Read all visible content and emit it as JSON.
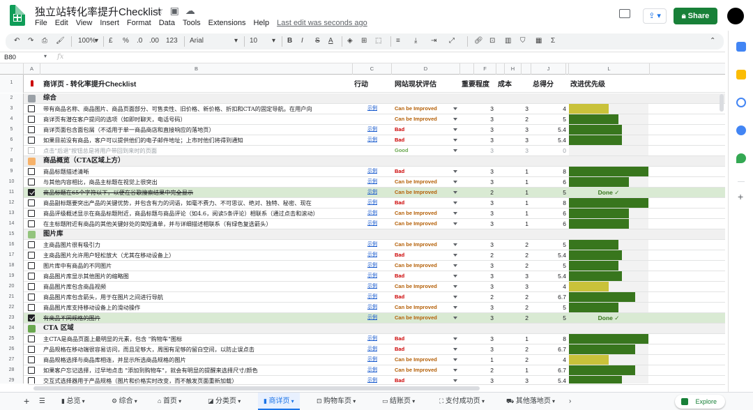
{
  "doc_title": "独立站转化率提升Checklist",
  "menu": [
    "File",
    "Edit",
    "View",
    "Insert",
    "Format",
    "Data",
    "Tools",
    "Extensions",
    "Help"
  ],
  "last_edit": "Last edit was seconds ago",
  "share_label": "Share",
  "toolbar": {
    "zoom": "100%",
    "currency": "£",
    "percent": "%",
    "dec_dec": ".0",
    "dec_inc": ".00",
    "format_more": "123",
    "font": "Arial",
    "font_size": "10",
    "bold": "B",
    "italic": "I",
    "strike": "S",
    "text_color": "A"
  },
  "name_box": "B80",
  "fx": "fx",
  "columns": [
    "A",
    "B",
    "C",
    "D",
    "",
    "F",
    "",
    "H",
    "",
    "J",
    "",
    "L"
  ],
  "header_row": {
    "num": "1",
    "title": "商详页 - 转化率提升Checklist",
    "action": "行动",
    "status": "网站现状评估",
    "importance": "重要程度",
    "cost": "成本",
    "total": "总得分",
    "priority": "改进优先级"
  },
  "colors": {
    "green_bar": "#38761d",
    "yellow_bar": "#c9c23a",
    "improved": "#b45f06",
    "bad": "#cc0000",
    "good": "#6aa84f",
    "share": "#188038",
    "done_bg": "#d9ead3"
  },
  "rows": [
    {
      "num": "2",
      "type": "section",
      "icon": "gear-icon",
      "text": "综合"
    },
    {
      "num": "3",
      "type": "item",
      "text": "带有商品名称、商品图片、商品页面部分、可售卖性、旧价格、新价格、折扣和CTA的固定导航。在用户向",
      "link": "示例",
      "status": "Can be Improved",
      "imp": "3",
      "cost": "3",
      "total": "4",
      "bar": 0.5,
      "barcolor": "yellow"
    },
    {
      "num": "4",
      "type": "item",
      "text": "商详页有潜在客户提问的选项（如即时聊天，电话号码）",
      "link": "",
      "status": "Can be Improved",
      "imp": "3",
      "cost": "2",
      "total": "5",
      "bar": 0.62,
      "barcolor": "green"
    },
    {
      "num": "5",
      "type": "item",
      "text": "商详页面包含面包屑（不适用于单一商品商店和直接响应的落地页）",
      "link": "示例",
      "status": "Bad",
      "imp": "3",
      "cost": "3",
      "total": "5.4",
      "bar": 0.67,
      "barcolor": "green"
    },
    {
      "num": "6",
      "type": "item",
      "text": "如果目前没有商品，客户可以提供他们的电子邮件地址；上市时他们将得到通知",
      "link": "示例",
      "status": "Bad",
      "imp": "3",
      "cost": "3",
      "total": "5.4",
      "bar": 0.67,
      "barcolor": "green"
    },
    {
      "num": "7",
      "type": "gray",
      "text": "点击\"后退\"按钮总是将用户带回到来时的页面",
      "link": "",
      "status": "Good",
      "imp": "3",
      "cost": "3",
      "total": "0",
      "bar": 0,
      "barcolor": "none"
    },
    {
      "num": "8",
      "type": "section",
      "icon": "ticket-icon",
      "text": "商品概览（CTA区域上方）"
    },
    {
      "num": "9",
      "type": "item",
      "text": "商品标题描述清晰",
      "link": "示例",
      "status": "Bad",
      "imp": "3",
      "cost": "1",
      "total": "8",
      "bar": 1.0,
      "barcolor": "green"
    },
    {
      "num": "10",
      "type": "item",
      "text": "与其他内容相比，商品主标题在视觉上很突出",
      "link": "示例",
      "status": "Can be Improved",
      "imp": "3",
      "cost": "1",
      "total": "6",
      "bar": 0.75,
      "barcolor": "green"
    },
    {
      "num": "11",
      "type": "done",
      "text": "商品标题在65个字符以下，以便在谷歌搜索结果中完全显示",
      "link": "示例",
      "status": "Can be Improved",
      "imp": "2",
      "cost": "1",
      "total": "5",
      "done": "Done ✓"
    },
    {
      "num": "12",
      "type": "item",
      "text": "商品副标题要突出产品的关键优势，并包含有力的词语，如毫不费力、不可思议、绝对、独特、秘密、现在",
      "link": "示例",
      "status": "Bad",
      "imp": "3",
      "cost": "1",
      "total": "8",
      "bar": 1.0,
      "barcolor": "green"
    },
    {
      "num": "13",
      "type": "item",
      "text": "商品评级概述显示在商品标题附近，商品标题与商品评论（如4.6，阅读5条评论）相联系（通过点击和滚动）",
      "link": "示例",
      "status": "Can be Improved",
      "imp": "3",
      "cost": "1",
      "total": "6",
      "bar": 0.75,
      "barcolor": "green"
    },
    {
      "num": "14",
      "type": "item",
      "text": "在主标题附近有商品的其他关键好处的简短清单，并与详细描述相联系（有绿色复选箭头）",
      "link": "示例",
      "status": "Can be Improved",
      "imp": "3",
      "cost": "1",
      "total": "6",
      "bar": 0.75,
      "barcolor": "green"
    },
    {
      "num": "15",
      "type": "section",
      "icon": "image-icon",
      "text": "图片库"
    },
    {
      "num": "16",
      "type": "item",
      "text": "主商品图片很有吸引力",
      "link": "示例",
      "status": "Can be Improved",
      "imp": "3",
      "cost": "2",
      "total": "5",
      "bar": 0.62,
      "barcolor": "green"
    },
    {
      "num": "17",
      "type": "item",
      "text": "主商品图片允许用户轻松放大（尤其在移动设备上）",
      "link": "示例",
      "status": "Bad",
      "imp": "2",
      "cost": "2",
      "total": "5.4",
      "bar": 0.67,
      "barcolor": "green"
    },
    {
      "num": "18",
      "type": "item",
      "text": "图片库中有商品的不同图片",
      "link": "示例",
      "status": "Can be Improved",
      "imp": "3",
      "cost": "2",
      "total": "5",
      "bar": 0.62,
      "barcolor": "green"
    },
    {
      "num": "19",
      "type": "item",
      "text": "商品图片库显示其他图片的缩略图",
      "link": "示例",
      "status": "Bad",
      "imp": "3",
      "cost": "3",
      "total": "5.4",
      "bar": 0.67,
      "barcolor": "green"
    },
    {
      "num": "20",
      "type": "item",
      "text": "商品图片库包含商品视频",
      "link": "示例",
      "status": "Can be Improved",
      "imp": "3",
      "cost": "3",
      "total": "4",
      "bar": 0.5,
      "barcolor": "yellow"
    },
    {
      "num": "21",
      "type": "item",
      "text": "商品图片库包含箭头，用于在图片之间进行导航",
      "link": "示例",
      "status": "Bad",
      "imp": "2",
      "cost": "2",
      "total": "6.7",
      "bar": 0.83,
      "barcolor": "green"
    },
    {
      "num": "22",
      "type": "item",
      "text": "商品图片库支持移动设备上的滑动操作",
      "link": "示例",
      "status": "Can be Improved",
      "imp": "3",
      "cost": "2",
      "total": "5",
      "bar": 0.62,
      "barcolor": "green"
    },
    {
      "num": "23",
      "type": "done",
      "text": "有商品不同规格的图片",
      "link": "示例",
      "status": "Can be Improved",
      "imp": "3",
      "cost": "2",
      "total": "5",
      "done": "Done ✓"
    },
    {
      "num": "24",
      "type": "section",
      "icon": "sparkle-icon",
      "text": "CTA 区域"
    },
    {
      "num": "25",
      "type": "item",
      "text": "主CTA是商品页面上最明显的元素，包含 \"购物车\"图标",
      "link": "示例",
      "status": "Bad",
      "imp": "3",
      "cost": "1",
      "total": "8",
      "bar": 1.0,
      "barcolor": "green"
    },
    {
      "num": "26",
      "type": "item",
      "text": "产品规格在移动端很容易访问，而且足够大，周围有足够的留白空间，以防止误点击",
      "link": "示例",
      "status": "Bad",
      "imp": "3",
      "cost": "2",
      "total": "6.7",
      "bar": 0.83,
      "barcolor": "green"
    },
    {
      "num": "27",
      "type": "item",
      "text": "商品规格选择与商品库相连，并显示所选商品规格的图片",
      "link": "示例",
      "status": "Can be Improved",
      "imp": "1",
      "cost": "2",
      "total": "4",
      "bar": 0.5,
      "barcolor": "yellow"
    },
    {
      "num": "28",
      "type": "item",
      "text": "如果客户忘记选择，过早地点击 \"添加到购物车\"，就会有明显的提醒来选择尺寸/颜色",
      "link": "示例",
      "status": "Can be Improved",
      "imp": "2",
      "cost": "1",
      "total": "6.7",
      "bar": 0.83,
      "barcolor": "green"
    },
    {
      "num": "29",
      "type": "item",
      "text": "交互式选择器用于产品规格（图片和价格实时改变，而不触发页面重新加载）",
      "link": "示例",
      "status": "Bad",
      "imp": "3",
      "cost": "3",
      "total": "5.4",
      "bar": 0.67,
      "barcolor": "green"
    }
  ],
  "sheet_tabs": [
    "总览",
    "综合",
    "首页",
    "分类页",
    "商详页",
    "购物车页",
    "结账页",
    "支付成功页",
    "其他落地页"
  ],
  "active_tab": "商详页",
  "explore_label": "Explore"
}
